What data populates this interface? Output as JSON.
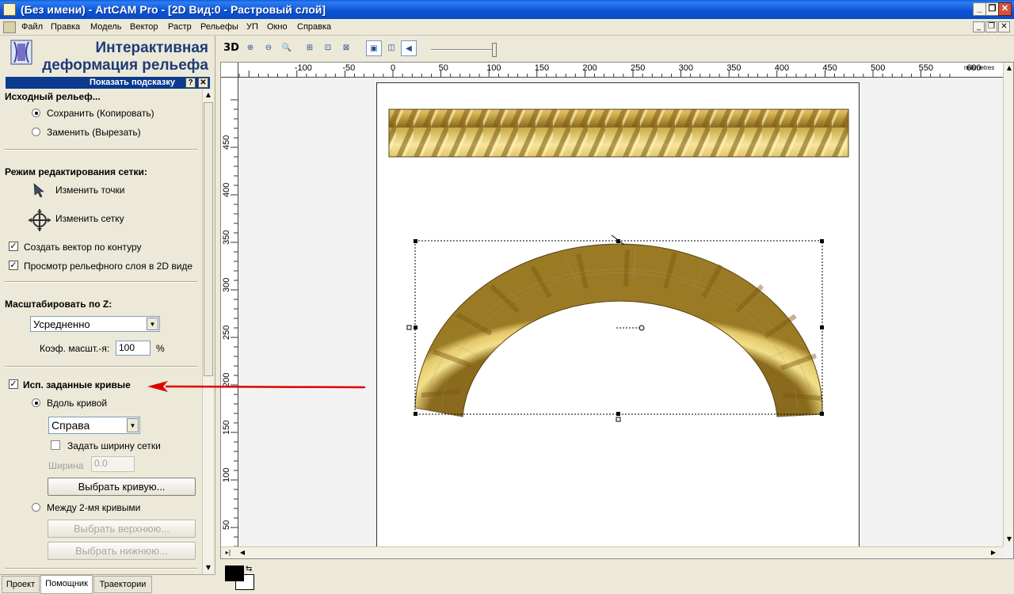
{
  "window": {
    "title": "(Без имени) - ArtCAM Pro - [2D Вид:0 - Растровый слой]",
    "minimize": "_",
    "restore": "❐",
    "close": "✕"
  },
  "menu": [
    "Файл",
    "Правка",
    "Модель",
    "Вектор",
    "Растр",
    "Рельефы",
    "УП",
    "Окно",
    "Справка"
  ],
  "mdi_buttons": {
    "minimize": "_",
    "restore": "❐",
    "close": "✕"
  },
  "panel": {
    "title_line1": "Интерактивная",
    "title_line2": "деформация рельефа",
    "hint": "Показать подсказку",
    "hint_help": "?",
    "hint_close": "✕",
    "source_heading": "Исходный рельеф...",
    "keep_copy": "Сохранить (Копировать)",
    "replace_cut": "Заменить (Вырезать)",
    "mesh_mode_heading": "Режим редактирования сетки:",
    "edit_points": "Изменить точки",
    "edit_mesh": "Изменить сетку",
    "create_vector": "Создать вектор по контуру",
    "preview_relief": "Просмотр рельефного слоя в 2D виде",
    "scale_z_heading": "Масштабировать по Z:",
    "scale_mode": "Усредненно",
    "scale_coef_label": "Коэф. масшт.-я:",
    "scale_coef_value": "100",
    "scale_coef_unit": "%",
    "use_curves": "Исп. заданные кривые",
    "along_curve": "Вдоль кривой",
    "side": "Справа",
    "set_mesh_width": "Задать ширину сетки",
    "width_label": "Ширина",
    "width_value": "0.0",
    "select_curve": "Выбрать кривую...",
    "between_curves": "Между 2-мя кривыми",
    "select_top": "Выбрать верхнюю...",
    "select_bottom": "Выбрать нижнюю..."
  },
  "tabs": [
    "Проект",
    "Помощник",
    "Траектории"
  ],
  "toolbar": {
    "label_3d": "3D"
  },
  "ruler": {
    "unit": "millimetres",
    "h_ticks": [
      "-100",
      "-50",
      "0",
      "50",
      "100",
      "150",
      "200",
      "250",
      "300",
      "350",
      "400",
      "450",
      "500",
      "550",
      "600"
    ],
    "v_ticks": [
      "450",
      "400",
      "350",
      "300",
      "250",
      "200",
      "150",
      "100",
      "50"
    ]
  },
  "colors": {
    "accent_title": "#0b56d9",
    "hint_bar": "#0b3a8e",
    "rope_light": "#f3e08a",
    "rope_dark": "#8a6a1c",
    "arrow": "#e00000"
  }
}
